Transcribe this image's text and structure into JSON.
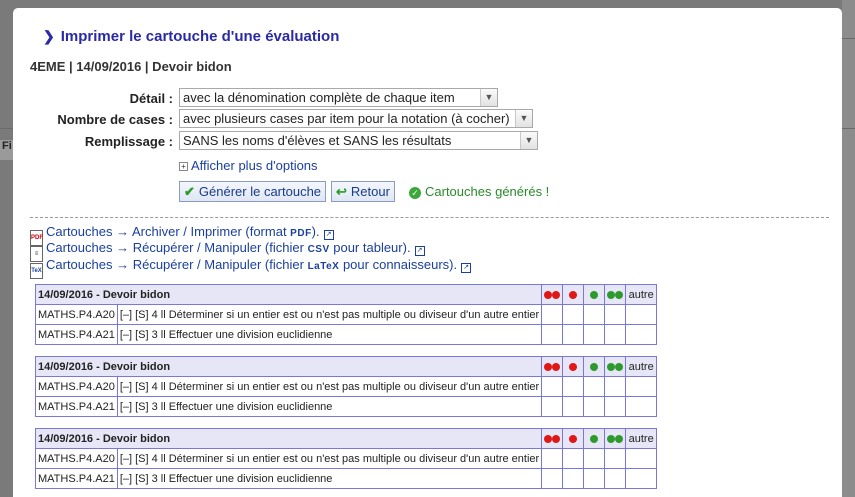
{
  "dialog": {
    "title": "Imprimer le cartouche d'une évaluation",
    "subtitle": "4EME | 14/09/2016 | Devoir bidon"
  },
  "form": {
    "detail": {
      "label": "Détail :",
      "value": "avec la dénomination complète de chaque item"
    },
    "nb_cases": {
      "label": "Nombre de cases :",
      "value": "avec plusieurs cases par item pour la notation (à cocher)"
    },
    "remplissage": {
      "label": "Remplissage :",
      "value": "SANS les noms d'élèves et SANS les résultats"
    },
    "more_options": "Afficher plus d'options",
    "generate_button": "Générer le cartouche",
    "back_button": "Retour",
    "status": "Cartouches générés !"
  },
  "links": [
    {
      "prefix": "Cartouches → Archiver / Imprimer (format ",
      "fmt": "PDF",
      "suffix": ").",
      "icon": "pdf-file-icon"
    },
    {
      "prefix": "Cartouches → Récupérer / Manipuler (fichier ",
      "fmt": "CSV",
      "suffix": " pour tableur).",
      "icon": "csv-file-icon"
    },
    {
      "prefix": "Cartouches → Récupérer / Manipuler (fichier ",
      "fmt": "LaTeX",
      "suffix": " pour connaisseurs).",
      "icon": "tex-file-icon"
    }
  ],
  "cartouche": {
    "header": "14/09/2016 - Devoir bidon",
    "autre": "autre",
    "rows": [
      {
        "code": "MATHS.P4.A20",
        "text": "[–] [S] 4 ll Déterminer si un entier est ou n'est pas multiple ou diviseur d'un autre entier"
      },
      {
        "code": "MATHS.P4.A21",
        "text": "[–] [S] 3 ll Effectuer une division euclidienne"
      }
    ]
  },
  "background": {
    "tab_label": "Fi"
  },
  "colors": {
    "accent": "#2a2aa8",
    "link": "#1a3fa0",
    "red": "#e01818",
    "green": "#2e9a2e",
    "table_border": "#7777dd",
    "table_head": "#e6e6f6"
  }
}
